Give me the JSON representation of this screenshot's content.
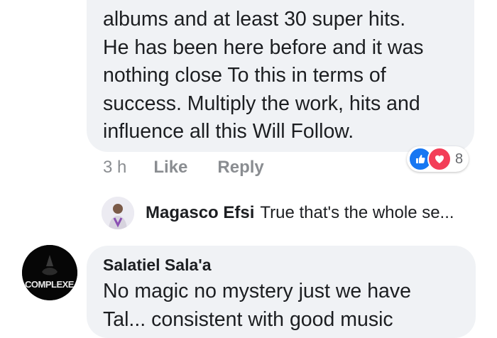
{
  "comment_top": {
    "lines": [
      "albums and at least 30 super hits.",
      "He has been here before and it was",
      "nothing close To this in terms of",
      "success. Multiply the work, hits and",
      "influence all this Will Follow."
    ],
    "time": "3 h",
    "like_label": "Like",
    "reply_label": "Reply",
    "reaction_count": "8"
  },
  "reply_preview": {
    "author": "Magasco Efsi",
    "text": "True that's the whole se..."
  },
  "comment_bottom": {
    "author": "Salatiel Sala'a",
    "avatar_label": "COMPLEXE",
    "lines": [
      "No magic no mystery just we have",
      "Tal... consistent with good music"
    ]
  },
  "colors": {
    "bubble_bg": "#f0f2f5",
    "meta_text": "#8a8d91",
    "like_blue": "#1877f2",
    "love_red": "#f33e58"
  }
}
